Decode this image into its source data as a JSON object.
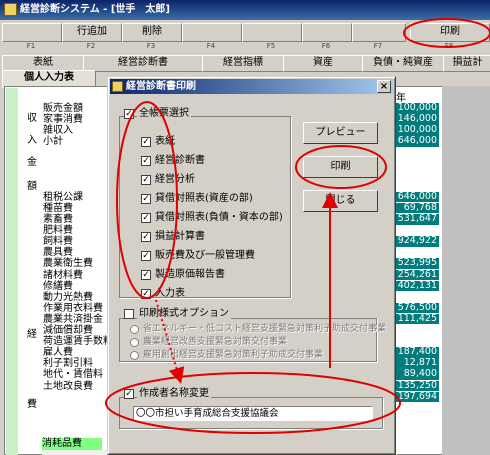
{
  "window": {
    "title": "経営診断システム - [世手　太郎]"
  },
  "toolbar": {
    "buttons": [
      {
        "label": "",
        "key": "F1"
      },
      {
        "label": "行追加",
        "key": "F2"
      },
      {
        "label": "削除",
        "key": "F3"
      },
      {
        "label": "",
        "key": "F4"
      },
      {
        "label": "",
        "key": "F5"
      },
      {
        "label": "",
        "key": "F6"
      },
      {
        "label": "",
        "key": "F7"
      },
      {
        "label": "印刷",
        "key": "F8"
      }
    ]
  },
  "top_tabs": [
    "表紙",
    "経営診断書",
    "経営指標",
    "資産",
    "負債・純資産",
    "損益計"
  ],
  "sub_tab": "個人入力表",
  "sheet": {
    "side_labels": [
      "収",
      "入",
      "金",
      "額",
      "経",
      "費"
    ],
    "rows": [
      "販売金額",
      "家事消費",
      "雑収入",
      "小計",
      "",
      "",
      "",
      "",
      "租税公課",
      "種苗費",
      "素畜費",
      "肥料費",
      "飼料費",
      "農具費",
      "農業衛生費",
      "諸材料費",
      "修繕費",
      "動力光熱費",
      "作業用衣料費",
      "農業共済掛金",
      "減価償却費",
      "荷造運賃手数料",
      "雇人費",
      "利子割引料",
      "地代・賃借料",
      "土地改良費"
    ],
    "year_label": "年",
    "values": [
      "100,000",
      "146,000",
      "100,000",
      "646,000",
      "",
      "",
      "",
      "",
      "646,000",
      "69,768",
      "531,647",
      "",
      "924,922",
      "",
      "523,995",
      "254,261",
      "402,131",
      "",
      "576,500",
      "111,425",
      "",
      "",
      "187,400",
      "12,871",
      "89,400",
      "135,250",
      "197,694"
    ],
    "consumables_label": "消耗品費"
  },
  "dialog": {
    "title": "経営診断書印刷",
    "close_glyph": "×",
    "select_all": {
      "label": "全帳票選択",
      "checked": true
    },
    "report_items": [
      {
        "label": "表紙",
        "checked": true
      },
      {
        "label": "経営診断書",
        "checked": true
      },
      {
        "label": "経営分析",
        "checked": true
      },
      {
        "label": "貸借対照表(資産の部)",
        "checked": true
      },
      {
        "label": "貸借対照表(負債・資本の部)",
        "checked": true
      },
      {
        "label": "損益計算書",
        "checked": true
      },
      {
        "label": "販売費及び一般管理費",
        "checked": true
      },
      {
        "label": "製造原価報告書",
        "checked": true
      },
      {
        "label": "入力表",
        "checked": true
      }
    ],
    "print_option": {
      "label": "印刷様式オプション",
      "checked": false
    },
    "radio_options": [
      "省エネルギー・低コスト経営支援緊急対策利子助成交付事業",
      "農業経営改善支援緊急対策交付事業",
      "雇用創出経営支援緊急対策利子助成交付事業"
    ],
    "creator_name": {
      "label": "作成者名称変更",
      "checked": true,
      "value": "〇〇市担い手育成総合支援協議会"
    },
    "buttons": {
      "preview": "プレビュー",
      "print": "印刷",
      "close": "閉じる"
    }
  },
  "colors": {
    "title_bar": "#0a246a",
    "highlight": "#e00000",
    "cell_bg": "#007c7c",
    "green_row": "#80ff80"
  }
}
